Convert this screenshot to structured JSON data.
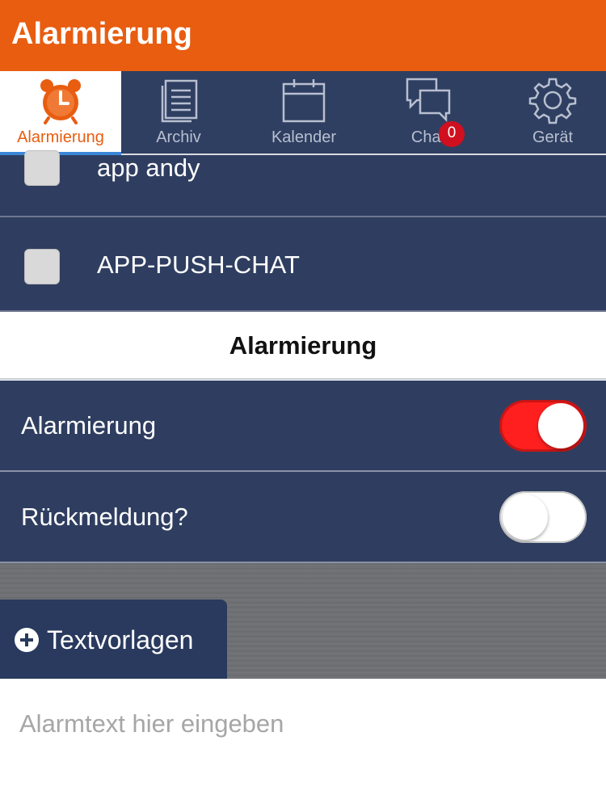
{
  "header": {
    "title": "Alarmierung"
  },
  "tabs": [
    {
      "label": "Alarmierung",
      "icon": "alarm-clock-icon",
      "active": true
    },
    {
      "label": "Archiv",
      "icon": "archive-icon",
      "active": false
    },
    {
      "label": "Kalender",
      "icon": "calendar-icon",
      "active": false
    },
    {
      "label": "Chat",
      "icon": "chat-icon",
      "active": false,
      "badge": "0"
    },
    {
      "label": "Gerät",
      "icon": "gear-icon",
      "active": false
    }
  ],
  "groups": [
    {
      "label": "app andy",
      "checked": false
    },
    {
      "label": "APP-PUSH-CHAT",
      "checked": false
    }
  ],
  "section": {
    "title": "Alarmierung"
  },
  "settings": [
    {
      "label": "Alarmierung",
      "on": true
    },
    {
      "label": "Rückmeldung?",
      "on": false
    }
  ],
  "textvorlagen": {
    "label": "Textvorlagen",
    "icon": "plus-circle-icon"
  },
  "alarmtext": {
    "placeholder": "Alarmtext hier eingeben",
    "value": ""
  },
  "colors": {
    "accent": "#e85d10",
    "nav": "#2f3f62",
    "toggle_on": "#ff1f1f",
    "badge": "#d0101e"
  }
}
